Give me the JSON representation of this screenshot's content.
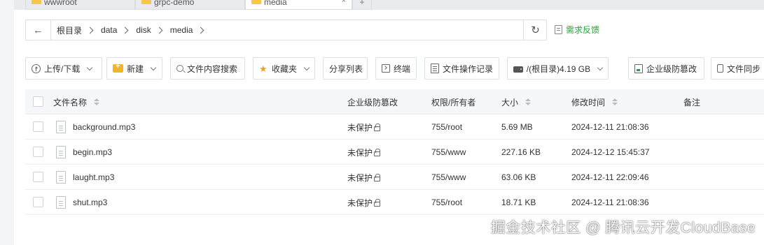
{
  "tabs": [
    {
      "label": "wwwroot",
      "active": false
    },
    {
      "label": "grpc-demo",
      "active": false
    },
    {
      "label": "media",
      "active": true
    }
  ],
  "tab_close": "×",
  "tab_add": "+",
  "address": {
    "back_icon": "arrow-left-icon",
    "crumbs": [
      "根目录",
      "data",
      "disk",
      "media"
    ],
    "refresh_icon": "refresh-icon"
  },
  "feedback": {
    "label": "需求反馈",
    "color": "#20a53a"
  },
  "toolbar": {
    "upload": "上传/下载",
    "new": "新建",
    "search": "文件内容搜索",
    "favorites": "收藏夹",
    "share_list": "分享列表",
    "terminal": "终端",
    "op_log": "文件操作记录",
    "disk": "/(根目录)4.19 GB",
    "tamper": "企业级防篡改",
    "sync": "文件同步"
  },
  "table": {
    "headers": {
      "name": "文件名称",
      "tamper": "企业级防篡改",
      "perm": "权限/所有者",
      "size": "大小",
      "mtime": "修改时间",
      "note": "备注"
    },
    "rows": [
      {
        "name": "background.mp3",
        "tamper": "未保护",
        "perm": "755/root",
        "size": "5.69 MB",
        "mtime": "2024-12-11 21:08:36"
      },
      {
        "name": "begin.mp3",
        "tamper": "未保护",
        "perm": "755/www",
        "size": "227.16 KB",
        "mtime": "2024-12-12 15:45:37"
      },
      {
        "name": "laught.mp3",
        "tamper": "未保护",
        "perm": "755/www",
        "size": "63.06 KB",
        "mtime": "2024-12-11 22:09:46"
      },
      {
        "name": "shut.mp3",
        "tamper": "未保护",
        "perm": "755/root",
        "size": "18.71 KB",
        "mtime": "2024-12-11 21:08:36"
      }
    ]
  },
  "watermark": "掘金技术社区 @ 腾讯云开发CloudBase"
}
